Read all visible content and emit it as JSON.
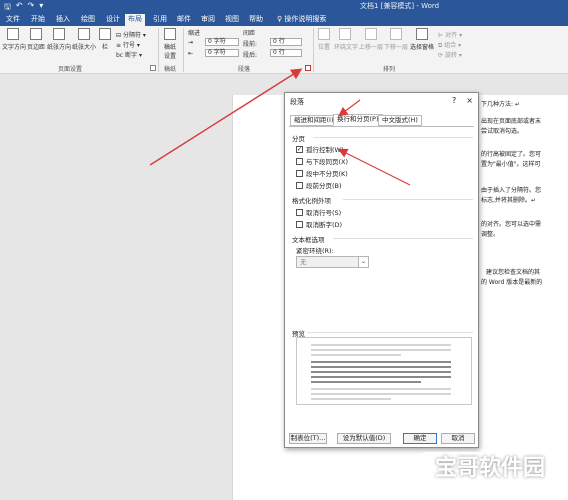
{
  "window": {
    "title": "文档1 [兼容模式] - Word",
    "qat_icons": [
      "save-icon",
      "undo-icon",
      "redo-icon",
      "more-icon"
    ]
  },
  "ribbon_tabs": [
    "文件",
    "开始",
    "插入",
    "绘图",
    "设计",
    "布局",
    "引用",
    "邮件",
    "审阅",
    "视图",
    "帮助"
  ],
  "tell_me": "操作说明搜索",
  "ribbon": {
    "text_direction": "文字方向",
    "margins": "页边距",
    "orientation": "纸张方向",
    "size": "纸张大小",
    "columns": "栏",
    "breaks": "分隔符",
    "line_numbers": "行号",
    "hyphenation": "断字",
    "page_setup_label": "页面设置",
    "draft": "稿纸\n设置",
    "draft_label": "稿纸",
    "indent_label": "缩进",
    "spacing_label": "间距",
    "indent_left_value": "0 字符",
    "indent_right_value": "0 字符",
    "space_before_label": "段前:",
    "space_after_label": "段后:",
    "space_before_value": "0 行",
    "space_after_value": "0 行",
    "paragraph_label": "段落",
    "position": "位置",
    "wrap_text": "环绕文字",
    "bring_forward": "上移一层",
    "send_backward": "下移一层",
    "selection_pane": "选择窗格",
    "align": "对齐",
    "group": "组合",
    "rotate": "旋转",
    "arrange_label": "排列"
  },
  "document": {
    "lines": [
      "下几种方法: ↵",
      "出现在页面底部或者末",
      "尝试取消勾选。",
      "的行高被固定了。您可",
      "置为\"最小值\"。这样可",
      "由于插入了分隔符。您",
      "标志,并将其删除。↵",
      "的对齐。您可以选中需",
      "调整。",
      "建议您检查文档的其",
      "的 Word 版本是最新的"
    ]
  },
  "dialog": {
    "title": "段落",
    "help": "?",
    "close": "×",
    "tabs": [
      "缩进和间距(I)",
      "换行和分页(P)",
      "中文版式(H)"
    ],
    "active_tab": 1,
    "sections": {
      "pagination": "分页",
      "format_exceptions": "格式化例外项",
      "textbox_options": "文本框选项",
      "preview": "预览"
    },
    "pagination_options": [
      {
        "label": "孤行控制(W)",
        "checked": true
      },
      {
        "label": "与下段同页(X)",
        "checked": false
      },
      {
        "label": "段中不分页(K)",
        "checked": false
      },
      {
        "label": "段前分页(B)",
        "checked": false
      }
    ],
    "exception_options": [
      {
        "label": "取消行号(S)",
        "checked": false
      },
      {
        "label": "取消断字(D)",
        "checked": false
      }
    ],
    "tight_wrap_label": "紧密环绕(R):",
    "tight_wrap_value": "无",
    "buttons": {
      "tabs": "制表位(T)...",
      "set_default": "设为默认值(D)",
      "ok": "确定",
      "cancel": "取消"
    }
  },
  "watermark": "宝哥软件园",
  "colors": {
    "word_blue": "#2b579a",
    "arrow_red": "#d93a3a"
  }
}
